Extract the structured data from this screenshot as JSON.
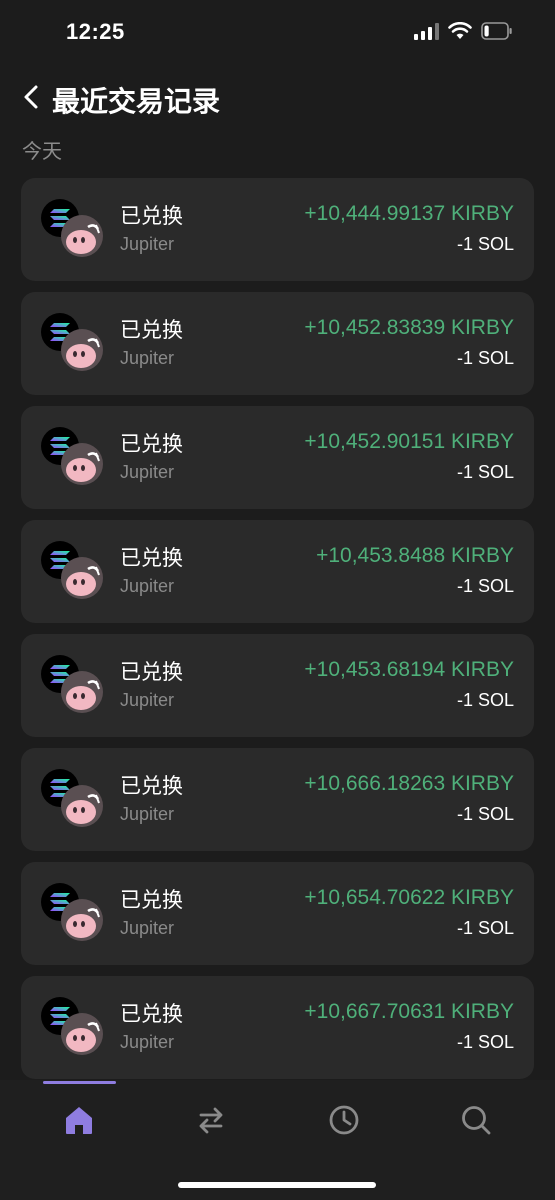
{
  "status": {
    "time": "12:25",
    "icons": [
      "signal-icon",
      "wifi-icon",
      "battery-icon"
    ],
    "battery_level": 0.2
  },
  "header": {
    "title": "最近交易记录",
    "back_icon": "chevron-left-icon"
  },
  "section_label": "今天",
  "colors": {
    "background": "#1c1c1c",
    "card": "#2a2a2a",
    "positive": "#4fb07a",
    "accent": "#8f7de0",
    "secondary_text": "#8a8a8a"
  },
  "transactions": [
    {
      "title": "已兑换",
      "source": "Jupiter",
      "amount_in": "+10,444.99137 KIRBY",
      "amount_out": "-1 SOL"
    },
    {
      "title": "已兑换",
      "source": "Jupiter",
      "amount_in": "+10,452.83839 KIRBY",
      "amount_out": "-1 SOL"
    },
    {
      "title": "已兑换",
      "source": "Jupiter",
      "amount_in": "+10,452.90151 KIRBY",
      "amount_out": "-1 SOL"
    },
    {
      "title": "已兑换",
      "source": "Jupiter",
      "amount_in": "+10,453.8488 KIRBY",
      "amount_out": "-1 SOL"
    },
    {
      "title": "已兑换",
      "source": "Jupiter",
      "amount_in": "+10,453.68194 KIRBY",
      "amount_out": "-1 SOL"
    },
    {
      "title": "已兑换",
      "source": "Jupiter",
      "amount_in": "+10,666.18263 KIRBY",
      "amount_out": "-1 SOL"
    },
    {
      "title": "已兑换",
      "source": "Jupiter",
      "amount_in": "+10,654.70622 KIRBY",
      "amount_out": "-1 SOL"
    },
    {
      "title": "已兑换",
      "source": "Jupiter",
      "amount_in": "+10,667.70631 KIRBY",
      "amount_out": "-1 SOL"
    }
  ],
  "tabs": [
    {
      "icon": "home-icon",
      "active": true
    },
    {
      "icon": "swap-icon",
      "active": false
    },
    {
      "icon": "clock-icon",
      "active": false
    },
    {
      "icon": "search-icon",
      "active": false
    }
  ]
}
